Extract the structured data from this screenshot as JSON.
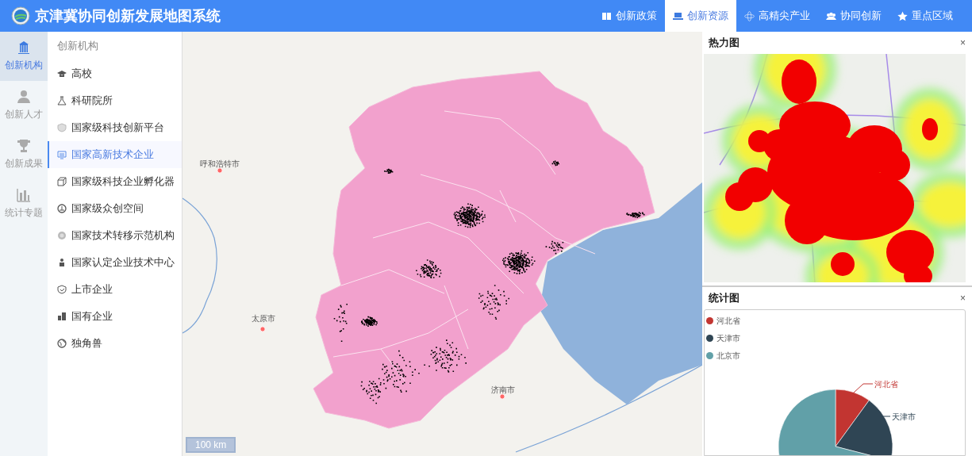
{
  "header": {
    "title": "京津冀协同创新发展地图系统"
  },
  "nav_tabs": [
    {
      "label": "创新政策",
      "selected": false
    },
    {
      "label": "创新资源",
      "selected": true
    },
    {
      "label": "高精尖产业",
      "selected": false
    },
    {
      "label": "协同创新",
      "selected": false
    },
    {
      "label": "重点区域",
      "selected": false
    }
  ],
  "rail": [
    {
      "label": "创新机构",
      "selected": true
    },
    {
      "label": "创新人才",
      "selected": false
    },
    {
      "label": "创新成果",
      "selected": false
    },
    {
      "label": "统计专题",
      "selected": false
    }
  ],
  "submenu": {
    "heading": "创新机构",
    "items": [
      {
        "label": "高校",
        "selected": false
      },
      {
        "label": "科研院所",
        "selected": false
      },
      {
        "label": "国家级科技创新平台",
        "selected": false
      },
      {
        "label": "国家高新技术企业",
        "selected": true
      },
      {
        "label": "国家级科技企业孵化器",
        "selected": false
      },
      {
        "label": "国家级众创空间",
        "selected": false
      },
      {
        "label": "国家技术转移示范机构",
        "selected": false
      },
      {
        "label": "国家认定企业技术中心",
        "selected": false
      },
      {
        "label": "上市企业",
        "selected": false
      },
      {
        "label": "国有企业",
        "selected": false
      },
      {
        "label": "独角兽",
        "selected": false
      }
    ]
  },
  "map": {
    "city_labels": [
      "呼和浩特市",
      "太原市",
      "济南市"
    ],
    "scale": "100 km"
  },
  "heat_panel": {
    "title": "热力图",
    "close": "×"
  },
  "stats_panel": {
    "title": "统计图",
    "close": "×",
    "legend": [
      {
        "label": "河北省",
        "color": "#c23531"
      },
      {
        "label": "天津市",
        "color": "#2f4554"
      },
      {
        "label": "北京市",
        "color": "#61a0a8"
      }
    ],
    "slice_labels": [
      "河北省",
      "天津市"
    ]
  }
}
